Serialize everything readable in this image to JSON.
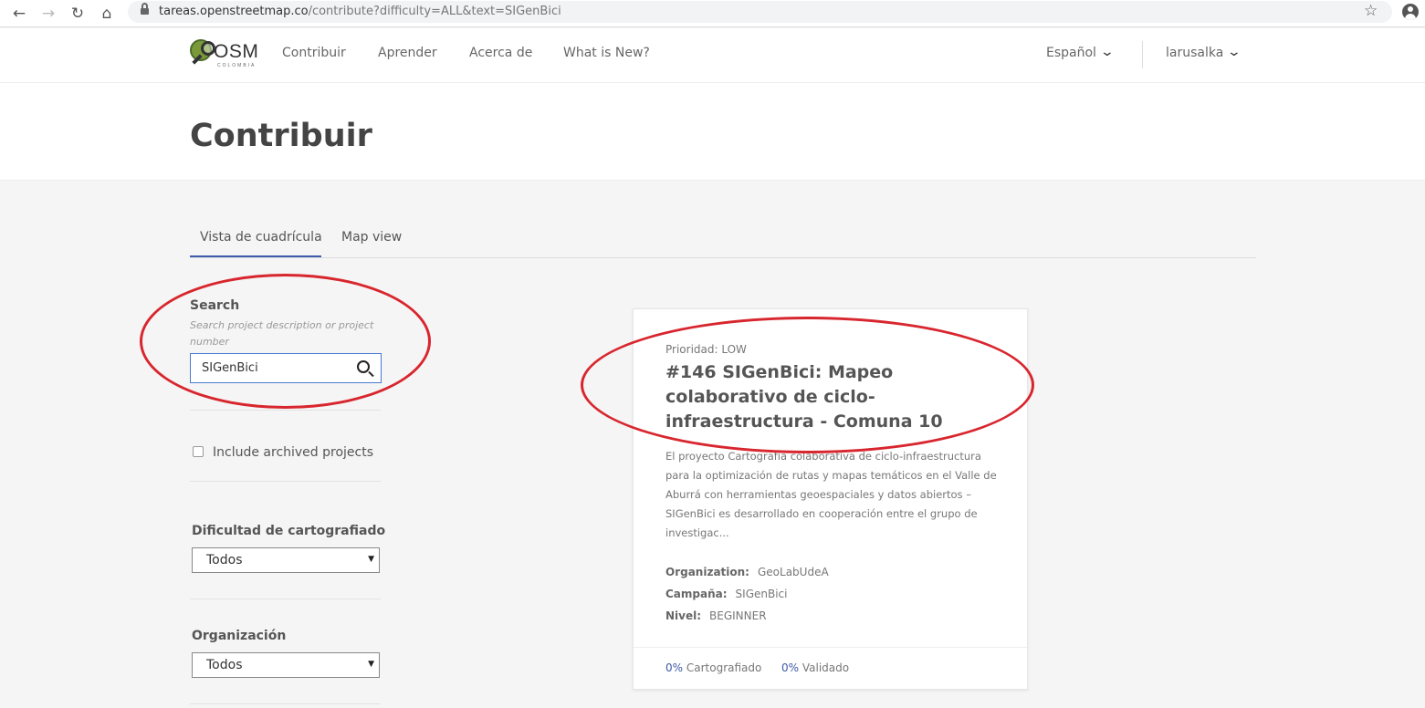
{
  "browser": {
    "url_host": "tareas.openstreetmap.co",
    "url_rest": "/contribute?difficulty=ALL&text=SIGenBici",
    "icons": [
      "back-arrow-icon",
      "forward-arrow-icon",
      "reload-icon",
      "home-icon",
      "lock-icon",
      "star-icon",
      "profile-icon"
    ]
  },
  "header": {
    "logo_text": "OSM",
    "logo_subtext": "COLOMBIA",
    "nav": [
      "Contribuir",
      "Aprender",
      "Acerca de",
      "What is New?"
    ],
    "language": "Español",
    "user": "larusalka"
  },
  "page": {
    "title": "Contribuir"
  },
  "tabs": {
    "grid": "Vista de cuadrícula",
    "map": "Map view"
  },
  "filters": {
    "search_label": "Search",
    "search_help": "Search project description or project number",
    "search_value": "SIGenBici",
    "archived_label": "Include archived projects",
    "difficulty_label": "Dificultad de cartografiado",
    "difficulty_value": "Todos",
    "organization_label": "Organización",
    "organization_value": "Todos"
  },
  "project": {
    "priority": "Prioridad: LOW",
    "title": "#146 SIGenBici: Mapeo colaborativo de ciclo-infraestructura - Comuna 10",
    "description": "El proyecto Cartografía colaborativa de ciclo-infraestructura para la optimización de rutas y mapas temáticos en el Valle de Aburrá con herramientas geoespaciales y datos abiertos – SIGenBici es desarrollado en cooperación entre el grupo de investigac...",
    "organization_label": "Organization:",
    "organization": "GeoLabUdeA",
    "campaign_label": "Campaña:",
    "campaign": "SIGenBici",
    "level_label": "Nivel:",
    "level": "BEGINNER",
    "mapped_pct": "0%",
    "mapped_label": "Cartografiado",
    "validated_pct": "0%",
    "validated_label": "Validado"
  },
  "colors": {
    "accent": "#3f5ba9",
    "annotation_red": "#d8262e"
  }
}
